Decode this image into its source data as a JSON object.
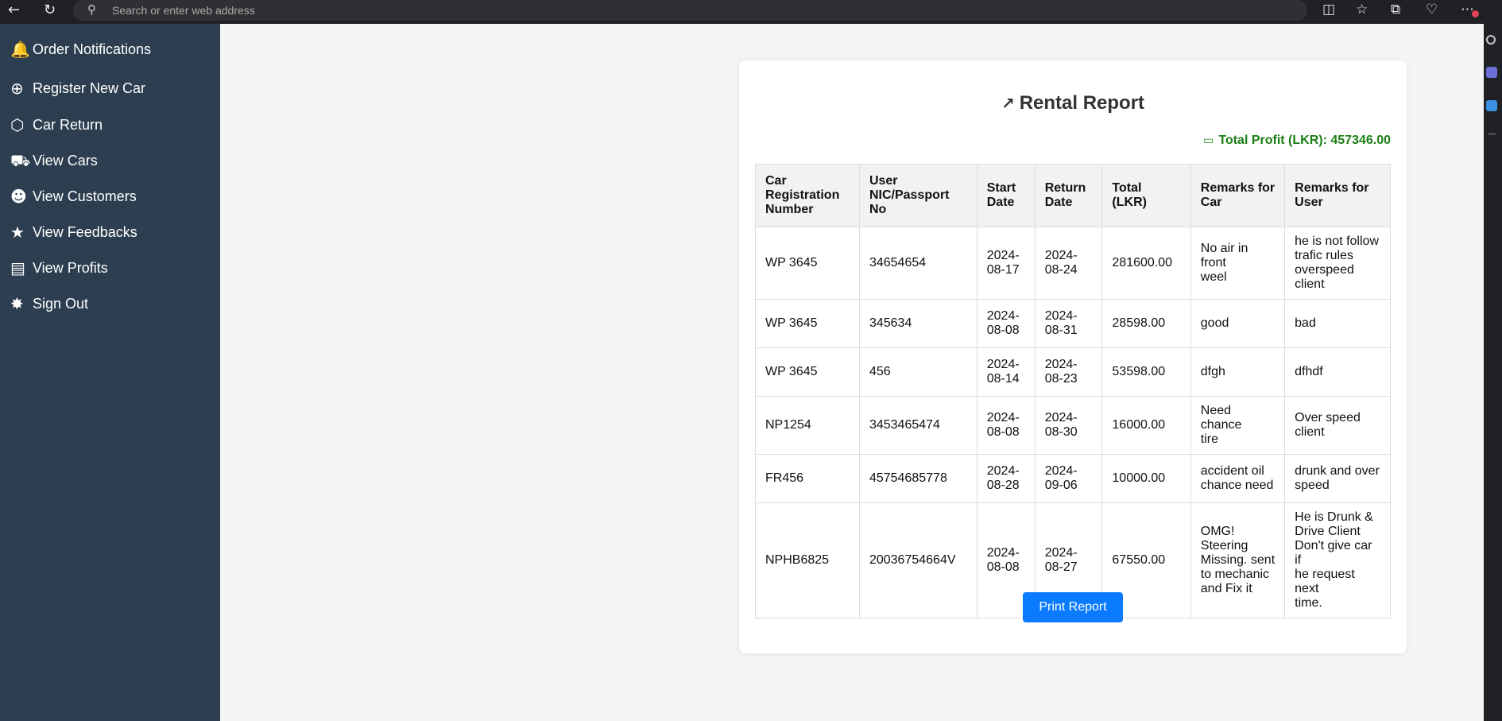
{
  "browser": {
    "address_placeholder": "Search or enter web address",
    "icons": [
      "back-icon",
      "reload-icon",
      "search-icon",
      "split-screen-icon",
      "favorites-icon",
      "collections-icon",
      "health-icon",
      "more-icon"
    ]
  },
  "sidebar": {
    "items": [
      {
        "label": "Order Notifications",
        "icon": "bell-icon"
      },
      {
        "label": "Register New Car",
        "icon": "plus-circle-icon"
      },
      {
        "label": "Car Return",
        "icon": "hexagon-icon"
      },
      {
        "label": "View Cars",
        "icon": "car-icon"
      },
      {
        "label": "View Customers",
        "icon": "people-icon"
      },
      {
        "label": "View Feedbacks",
        "icon": "star-icon"
      },
      {
        "label": "View Profits",
        "icon": "money-icon"
      },
      {
        "label": "Sign Out",
        "icon": "walking-icon"
      }
    ]
  },
  "report": {
    "title": "Rental Report",
    "profit": "Total Profit (LKR): 457346.00",
    "print_label": "Print Report",
    "headers": {
      "car_reg": [
        "Car",
        "Registration",
        "Number"
      ],
      "user_id": [
        "User",
        "NIC/Passport",
        "No"
      ],
      "start": [
        "Start",
        "Date"
      ],
      "return": [
        "Return",
        "Date"
      ],
      "total": [
        "Total",
        "(LKR)"
      ],
      "remarks_car": [
        "Remarks for",
        "Car"
      ],
      "remarks_user": [
        "Remarks for",
        "User"
      ]
    },
    "rows": [
      {
        "car": "WP 3645",
        "user": "34654654",
        "start": [
          "2024-",
          "08-17"
        ],
        "ret": [
          "2024-",
          "08-24"
        ],
        "total": "281600.00",
        "rcar": [
          "No air in front",
          "weel"
        ],
        "ruser": [
          "he is not follow",
          "trafic rules",
          "overspeed client"
        ]
      },
      {
        "car": "WP 3645",
        "user": "345634",
        "start": [
          "2024-",
          "08-08"
        ],
        "ret": [
          "2024-",
          "08-31"
        ],
        "total": "28598.00",
        "rcar": [
          "good"
        ],
        "ruser": [
          "bad"
        ]
      },
      {
        "car": "WP 3645",
        "user": "456",
        "start": [
          "2024-",
          "08-14"
        ],
        "ret": [
          "2024-",
          "08-23"
        ],
        "total": "53598.00",
        "rcar": [
          "dfgh"
        ],
        "ruser": [
          "dfhdf"
        ]
      },
      {
        "car": "NP1254",
        "user": "3453465474",
        "start": [
          "2024-",
          "08-08"
        ],
        "ret": [
          "2024-",
          "08-30"
        ],
        "total": "16000.00",
        "rcar": [
          "Need chance",
          "tire"
        ],
        "ruser": [
          "Over speed",
          "client"
        ]
      },
      {
        "car": "FR456",
        "user": "45754685778",
        "start": [
          "2024-",
          "08-28"
        ],
        "ret": [
          "2024-",
          "09-06"
        ],
        "total": "10000.00",
        "rcar": [
          "accident oil",
          "chance need"
        ],
        "ruser": [
          "drunk and over",
          "speed"
        ]
      },
      {
        "car": "NPHB6825",
        "user": "20036754664V",
        "start": [
          "2024-",
          "08-08"
        ],
        "ret": [
          "2024-",
          "08-27"
        ],
        "total": "67550.00",
        "rcar": [
          "OMG!",
          "Steering",
          "Missing. sent",
          "to mechanic",
          "and Fix it"
        ],
        "ruser": [
          "He is Drunk &",
          "Drive Client",
          "Don't give car if",
          "he request next",
          "time."
        ]
      }
    ]
  }
}
